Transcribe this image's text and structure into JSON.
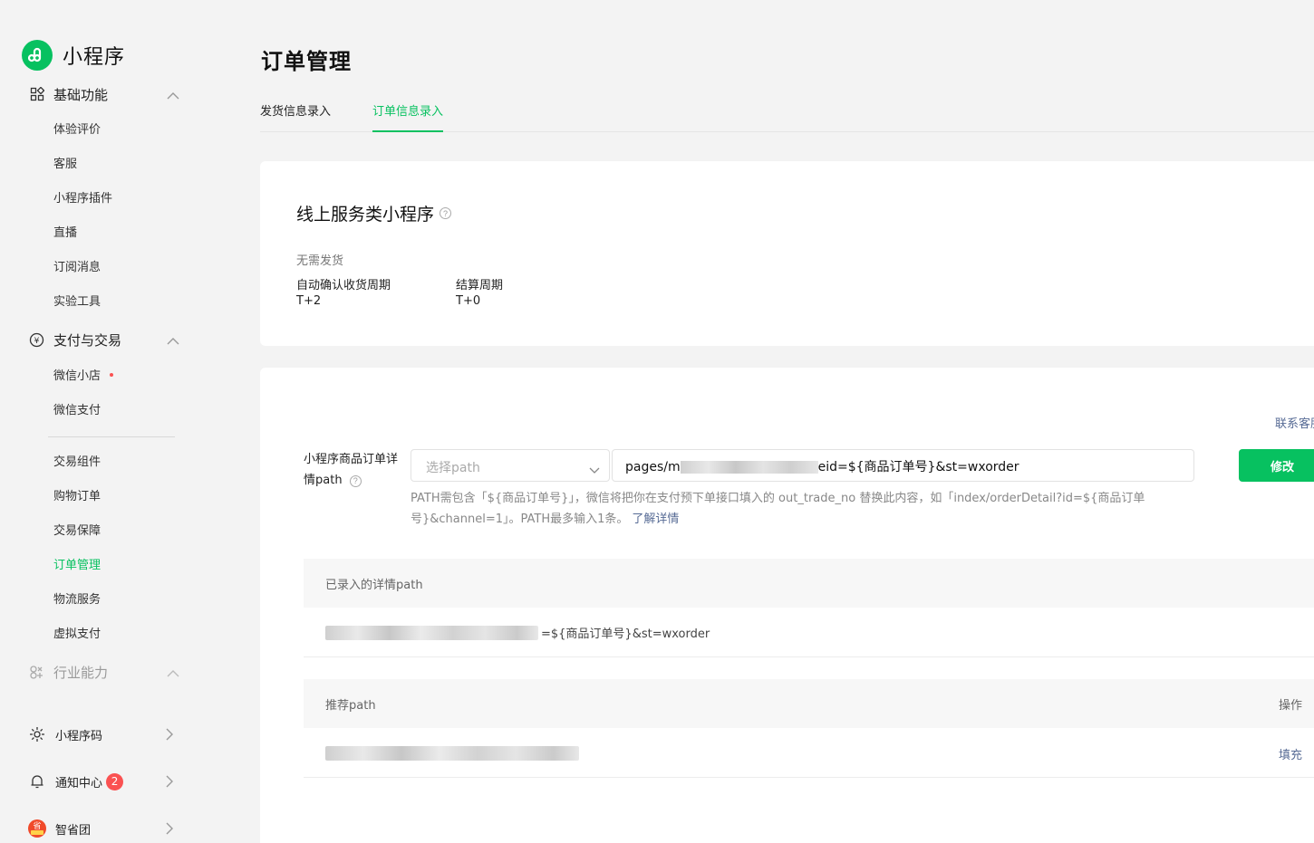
{
  "app": {
    "name": "小程序"
  },
  "sidebar": {
    "groups": [
      {
        "label": "基础功能",
        "icon": "grid-icon",
        "items": [
          "体验评价",
          "客服",
          "小程序插件",
          "直播",
          "订阅消息",
          "实验工具"
        ]
      },
      {
        "label": "支付与交易",
        "icon": "yuan-circle-icon",
        "items": [
          "微信小店",
          "微信支付"
        ],
        "items2": [
          "交易组件",
          "购物订单",
          "交易保障",
          "订单管理",
          "物流服务",
          "虚拟支付"
        ]
      },
      {
        "label": "行业能力",
        "icon": "industry-icon"
      }
    ],
    "active_item": "订单管理",
    "bottom": [
      {
        "label": "小程序码",
        "icon": "qrcode-sun-icon"
      },
      {
        "label": "通知中心",
        "icon": "bell-icon",
        "badge": "2"
      },
      {
        "label": "智省团",
        "icon": "zhishengtuan-logo-icon"
      }
    ]
  },
  "page": {
    "title": "订单管理"
  },
  "tabs": [
    {
      "label": "发货信息录入",
      "active": false
    },
    {
      "label": "订单信息录入",
      "active": true
    }
  ],
  "service": {
    "title": "线上服务类小程序",
    "no_shipping": "无需发货",
    "confirm_label": "自动确认收货周期",
    "confirm_value": "T+2",
    "settle_label": "结算周期",
    "settle_value": "T+0"
  },
  "path_config": {
    "contact_link": "联系客服",
    "label": "小程序商品订单详情path",
    "select_placeholder": "选择path",
    "input_prefix": "pages/m",
    "input_suffix": "eid=${商品订单号}&st=wxorder",
    "modify_button": "修改",
    "hint": "PATH需包含「${商品订单号}」，微信将把你在支付预下单接口填入的 out_trade_no 替换此内容，如「index/orderDetail?id=${商品订单号}&channel=1」。PATH最多输入1条。",
    "hint_link": "了解详情"
  },
  "recorded": {
    "header": "已录入的详情path",
    "row_suffix": "=${商品订单号}&st=wxorder"
  },
  "recommended": {
    "header": "推荐path",
    "op_header": "操作",
    "fill_link": "填充"
  },
  "colors": {
    "brand": "#07c160",
    "link": "#576b95",
    "badge": "#fa5151"
  }
}
